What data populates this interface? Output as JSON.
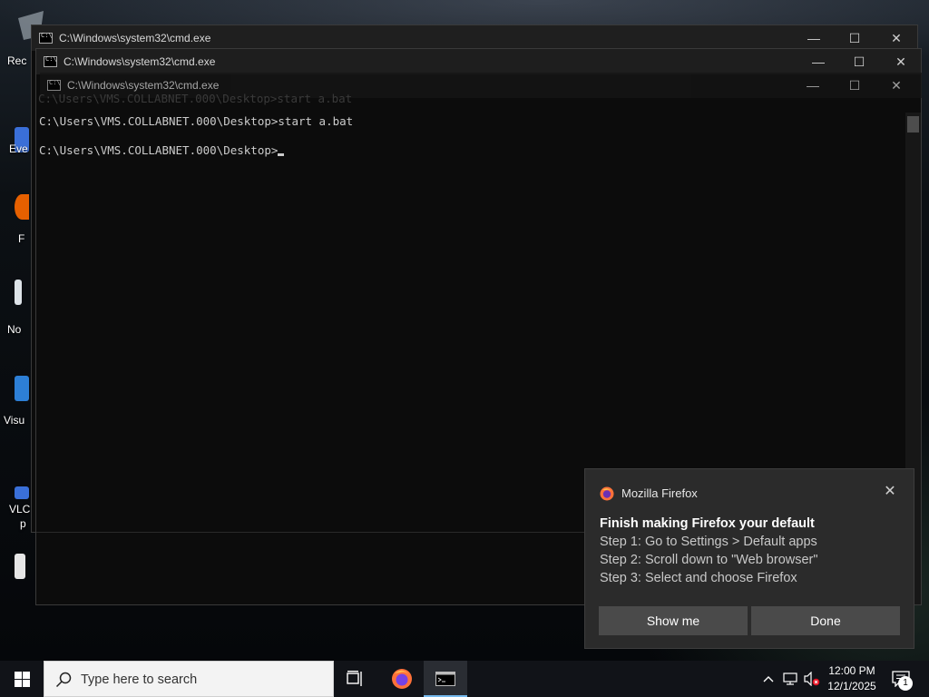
{
  "desktop": {
    "icons": [
      {
        "label": "Rec"
      },
      {
        "label": "Eve"
      },
      {
        "label": "F"
      },
      {
        "label": "No"
      },
      {
        "label": "Visu"
      },
      {
        "label": "VLC"
      },
      {
        "label": "p"
      }
    ]
  },
  "windows": [
    {
      "title": "C:\\Windows\\system32\\cmd.exe"
    },
    {
      "title": "C:\\Windows\\system32\\cmd.exe"
    },
    {
      "title": "C:\\Windows\\system32\\cmd.exe"
    }
  ],
  "window_controls": {
    "minimize": "—",
    "maximize": "☐",
    "close": "✕"
  },
  "console": {
    "ghost_line": "C:\\Users\\VMS.COLLABNET.000\\Desktop>start a.bat",
    "line1": "C:\\Users\\VMS.COLLABNET.000\\Desktop>start a.bat",
    "line2": "C:\\Users\\VMS.COLLABNET.000\\Desktop>"
  },
  "toast": {
    "app_name": "Mozilla Firefox",
    "close": "✕",
    "heading": "Finish making Firefox your default",
    "steps": [
      "Step 1: Go to Settings > Default apps",
      "Step 2: Scroll down to \"Web browser\"",
      "Step 3: Select and choose Firefox"
    ],
    "buttons": {
      "show_me": "Show me",
      "done": "Done"
    },
    "icon": "firefox-icon"
  },
  "taskbar": {
    "search_placeholder": "Type here to search",
    "time": "12:00 PM",
    "date": "12/1/2025",
    "notification_count": "1",
    "pinned": [
      "task-view-icon",
      "firefox-icon",
      "cmd-icon"
    ],
    "tray_icons": [
      "chevron-up-icon",
      "network-icon",
      "volume-muted-icon",
      "notification-icon"
    ],
    "accent": "#76b9ed"
  }
}
